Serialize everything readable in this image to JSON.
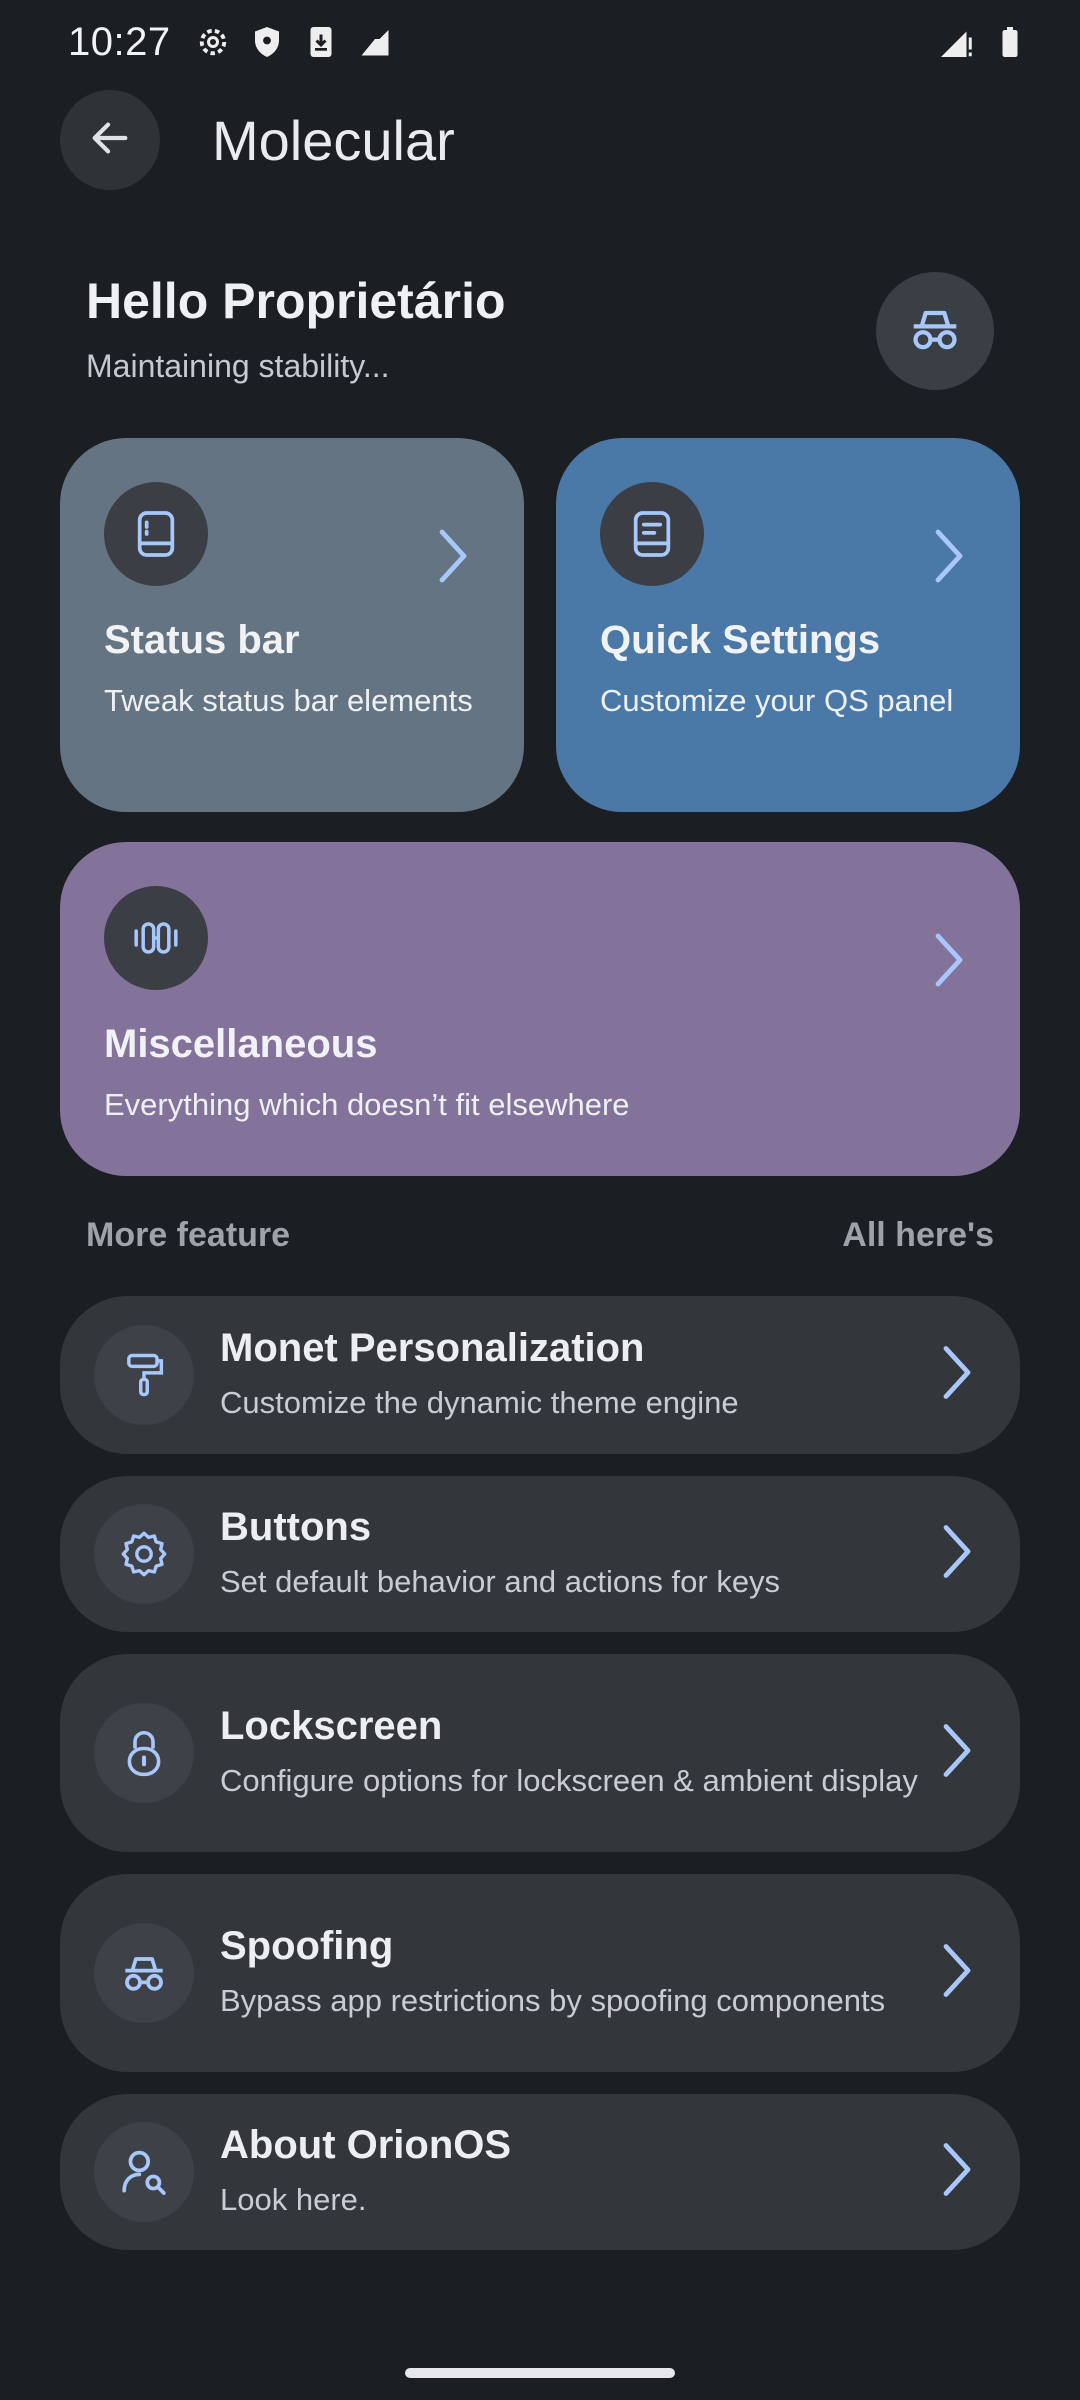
{
  "status_bar": {
    "time": "10:27",
    "left_icons": [
      "gear-icon",
      "shield-icon",
      "download-icon",
      "signal-triangle-icon"
    ],
    "right_icons": [
      "cell-signal-icon",
      "battery-icon"
    ]
  },
  "header": {
    "title": "Molecular",
    "back_icon": "arrow-left-icon"
  },
  "greeting": {
    "title": "Hello Proprietário",
    "subtitle": "Maintaining stability..."
  },
  "cards": {
    "status_bar": {
      "title": "Status bar",
      "subtitle": "Tweak status bar elements",
      "color": "#657483"
    },
    "quick_settings": {
      "title": "Quick Settings",
      "subtitle": "Customize your QS panel",
      "color": "#4a79a7"
    },
    "misc": {
      "title": "Miscellaneous",
      "subtitle": "Everything which doesn’t fit elsewhere",
      "color": "#83729a"
    }
  },
  "section": {
    "left": "More feature",
    "right": "All here's"
  },
  "rows": [
    {
      "title": "Monet Personalization",
      "subtitle": "Customize the dynamic theme engine",
      "icon": "paint-roller-icon"
    },
    {
      "title": "Buttons",
      "subtitle": "Set default behavior and actions for keys",
      "icon": "gear-icon"
    },
    {
      "title": "Lockscreen",
      "subtitle": "Configure options for lockscreen & ambient display",
      "icon": "lock-icon"
    },
    {
      "title": "Spoofing",
      "subtitle": "Bypass app restrictions by spoofing components",
      "icon": "incognito-icon"
    },
    {
      "title": "About OrionOS",
      "subtitle": "Look here.",
      "icon": "person-search-icon"
    }
  ],
  "colors": {
    "background": "#1b1e22",
    "accent_icon": "#a8c8fb",
    "row_background": "#33363b"
  }
}
